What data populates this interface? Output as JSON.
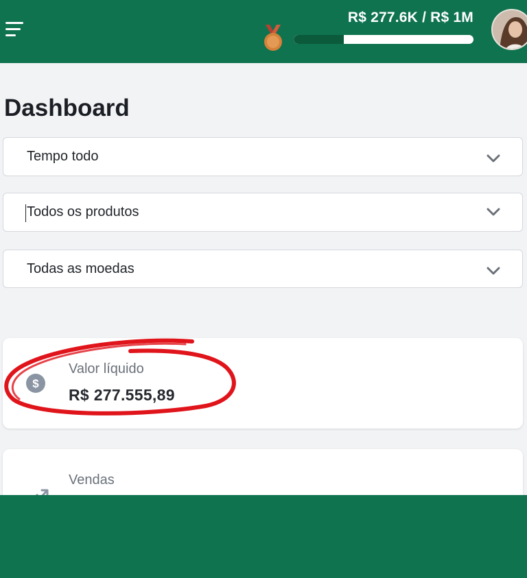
{
  "header": {
    "menu_icon": "hamburger-menu-icon",
    "medal_icon": "bronze-medal-icon",
    "goal_text": "R$ 277.6K / R$ 1M",
    "goal_progress": 0.2776,
    "avatar": "user-avatar"
  },
  "page": {
    "title": "Dashboard"
  },
  "filters": [
    {
      "label": "Tempo todo",
      "icon": "chevron-down-icon"
    },
    {
      "label": "Todos os produtos",
      "icon": "chevron-down-icon"
    },
    {
      "label": "Todas as moedas",
      "icon": "chevron-down-icon"
    }
  ],
  "cards": [
    {
      "label": "Valor líquido",
      "value": "R$ 277.555,89",
      "icon": "dollar-coin-icon"
    },
    {
      "label": "Vendas",
      "icon": "trending-up-icon"
    }
  ],
  "colors": {
    "brand_green": "#0f7350",
    "progress_dark": "#0b5a3c",
    "medal_bronze": "#d6813a",
    "medal_ribbon": "#b8402f",
    "annotation_red": "#e0141b",
    "background": "#f2f3f5"
  }
}
